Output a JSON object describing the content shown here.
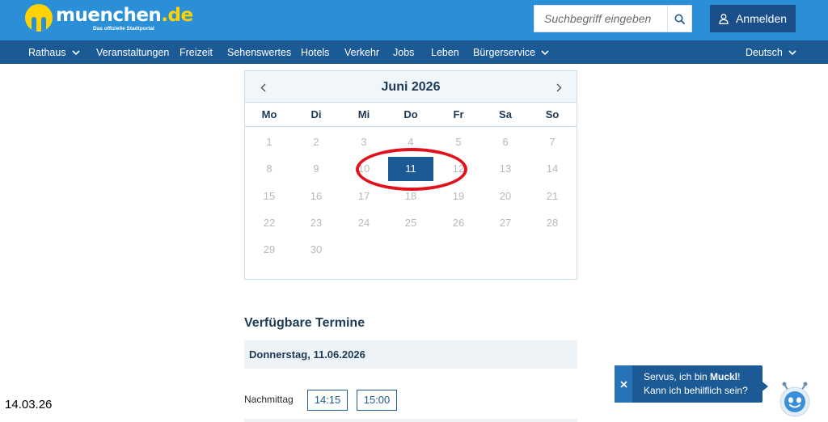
{
  "header": {
    "logo_main": "muenchen",
    "logo_tld": ".de",
    "logo_sub": "Das offizielle Stadtportal",
    "search_placeholder": "Suchbegriff eingeben",
    "search_icon": "search-icon",
    "login_label": "Anmelden",
    "login_icon": "user-icon",
    "brand_color": "#2a8fd6",
    "accent_yellow": "#ffd200"
  },
  "nav": {
    "items": [
      {
        "label": "Rathaus",
        "dropdown": true
      },
      {
        "label": "Veranstaltungen",
        "dropdown": false
      },
      {
        "label": "Freizeit",
        "dropdown": false
      },
      {
        "label": "Sehenswertes",
        "dropdown": false
      },
      {
        "label": "Hotels",
        "dropdown": false
      },
      {
        "label": "Verkehr",
        "dropdown": false
      },
      {
        "label": "Jobs",
        "dropdown": false
      },
      {
        "label": "Leben",
        "dropdown": false
      },
      {
        "label": "Bürgerservice",
        "dropdown": true
      }
    ],
    "language": "Deutsch",
    "color": "#1c5a96"
  },
  "calendar": {
    "month_title": "Juni 2026",
    "prev_icon": "chevron-left-icon",
    "next_icon": "chevron-right-icon",
    "weekdays": [
      "Mo",
      "Di",
      "Mi",
      "Do",
      "Fr",
      "Sa",
      "So"
    ],
    "weeks": [
      [
        "1",
        "2",
        "3",
        "4",
        "5",
        "6",
        "7"
      ],
      [
        "8",
        "9",
        "10",
        "11",
        "12",
        "13",
        "14"
      ],
      [
        "15",
        "16",
        "17",
        "18",
        "19",
        "20",
        "21"
      ],
      [
        "22",
        "23",
        "24",
        "25",
        "26",
        "27",
        "28"
      ],
      [
        "29",
        "30",
        "",
        "",
        "",
        "",
        ""
      ]
    ],
    "selected_day": "11",
    "highlight_color": "#e1111d"
  },
  "appointments": {
    "title": "Verfügbare Termine",
    "date_label": "Donnerstag, 11.06.2026",
    "period_label": "Nachmittag",
    "slots": [
      "14:15",
      "15:00"
    ]
  },
  "timestamp": "14.03.26",
  "chat": {
    "close_icon": "close-icon",
    "line1_prefix": "Servus, ich bin ",
    "line1_name": "Muckl",
    "line1_suffix": "!",
    "line2": "Kann ich behilflich sein?",
    "mascot_icon": "chatbot-mascot-icon"
  }
}
